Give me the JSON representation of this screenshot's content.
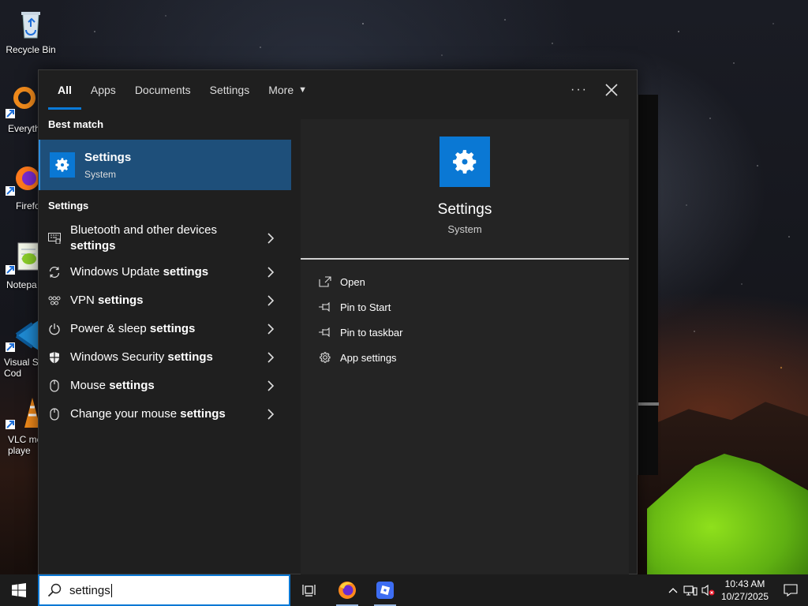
{
  "desktop": {
    "icons": [
      {
        "label": "Recycle Bin"
      },
      {
        "label": "Everyth"
      },
      {
        "label": "Firefo"
      },
      {
        "label": "Notepa"
      },
      {
        "label": "Visual St\nCod"
      },
      {
        "label": "VLC me\nplaye"
      }
    ]
  },
  "search": {
    "tabs": [
      {
        "label": "All",
        "active": true
      },
      {
        "label": "Apps"
      },
      {
        "label": "Documents"
      },
      {
        "label": "Settings"
      },
      {
        "label": "More"
      }
    ],
    "more_icon": "more-dots-icon",
    "close_icon": "close-icon",
    "best_match_heading": "Best match",
    "best_match": {
      "title": "Settings",
      "subtitle": "System",
      "icon": "gear-icon"
    },
    "settings_heading": "Settings",
    "results": [
      {
        "line1": "Bluetooth and other devices",
        "line2_bold": "settings",
        "icon": "bluetooth-devices-icon"
      },
      {
        "text": "Windows Update ",
        "bold": "settings",
        "icon": "sync-icon"
      },
      {
        "text": "VPN ",
        "bold": "settings",
        "icon": "vpn-icon"
      },
      {
        "text": "Power & sleep ",
        "bold": "settings",
        "icon": "power-icon"
      },
      {
        "text": "Windows Security ",
        "bold": "settings",
        "icon": "shield-icon"
      },
      {
        "text": "Mouse ",
        "bold": "settings",
        "icon": "mouse-icon"
      },
      {
        "text": "Change your mouse ",
        "bold": "settings",
        "icon": "mouse-icon"
      }
    ],
    "preview": {
      "title": "Settings",
      "subtitle": "System",
      "actions": [
        {
          "label": "Open",
          "icon": "open-icon"
        },
        {
          "label": "Pin to Start",
          "icon": "pin-icon"
        },
        {
          "label": "Pin to taskbar",
          "icon": "pin-icon"
        },
        {
          "label": "App settings",
          "icon": "gear-icon"
        }
      ]
    }
  },
  "taskbar": {
    "search_value": "settings",
    "clock_time": "10:43 AM",
    "clock_date": "10/27/2025"
  },
  "colors": {
    "accent": "#0a78d4",
    "selection": "#1e4f7a"
  }
}
